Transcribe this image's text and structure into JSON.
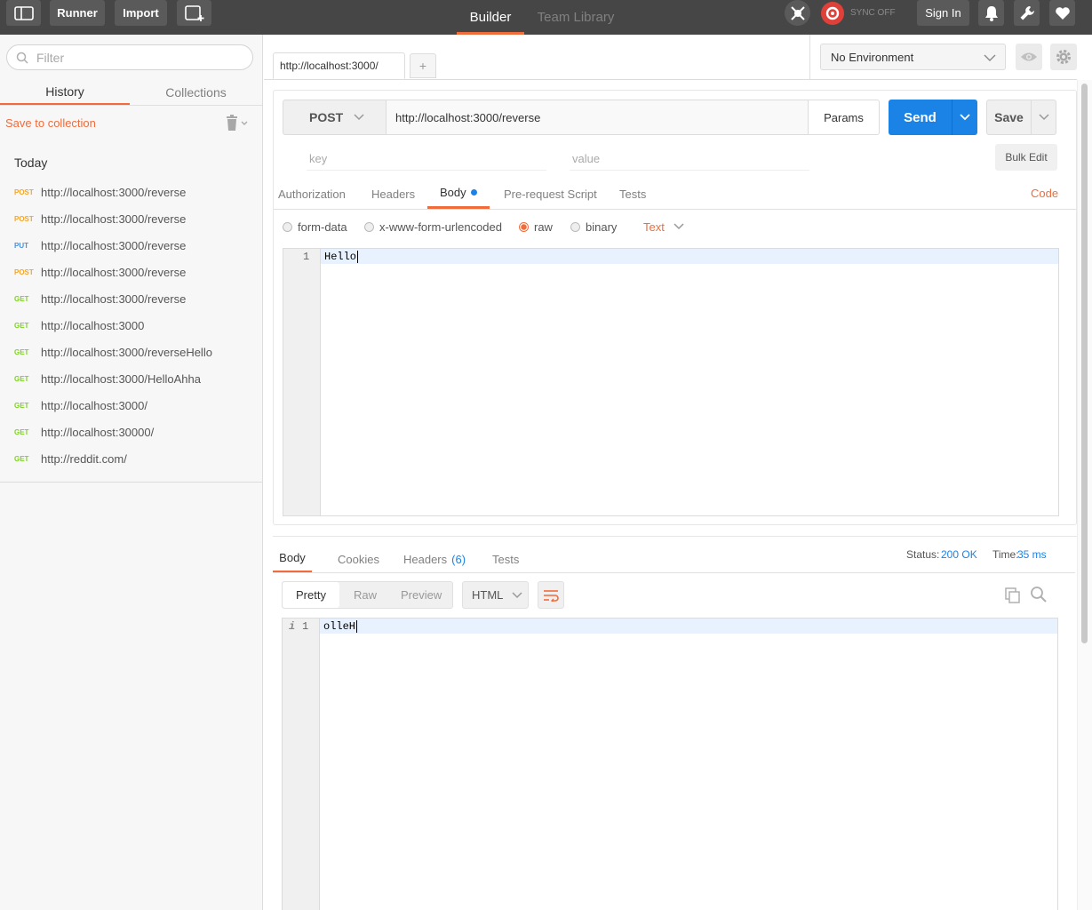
{
  "topbar": {
    "runner_label": "Runner",
    "import_label": "Import",
    "builder_label": "Builder",
    "team_library_label": "Team Library",
    "sync_label": "SYNC OFF",
    "sign_in_label": "Sign In"
  },
  "sidebar": {
    "filter_placeholder": "Filter",
    "tabs": [
      {
        "label": "History"
      },
      {
        "label": "Collections"
      }
    ],
    "save_to_collection": "Save to collection",
    "group_label": "Today",
    "history": [
      {
        "method": "POST",
        "url": "http://localhost:3000/reverse"
      },
      {
        "method": "POST",
        "url": "http://localhost:3000/reverse"
      },
      {
        "method": "PUT",
        "url": "http://localhost:3000/reverse"
      },
      {
        "method": "POST",
        "url": "http://localhost:3000/reverse"
      },
      {
        "method": "GET",
        "url": "http://localhost:3000/reverse"
      },
      {
        "method": "GET",
        "url": "http://localhost:3000"
      },
      {
        "method": "GET",
        "url": "http://localhost:3000/reverseHello"
      },
      {
        "method": "GET",
        "url": "http://localhost:3000/HelloAhha"
      },
      {
        "method": "GET",
        "url": "http://localhost:3000/"
      },
      {
        "method": "GET",
        "url": "http://localhost:30000/"
      },
      {
        "method": "GET",
        "url": "http://reddit.com/"
      }
    ]
  },
  "main": {
    "tab_label": "http://localhost:3000/",
    "new_tab_label": "+",
    "environment": "No Environment",
    "request": {
      "method": "POST",
      "url": "http://localhost:3000/reverse",
      "params_label": "Params",
      "send_label": "Send",
      "save_label": "Save",
      "key_placeholder": "key",
      "value_placeholder": "value",
      "bulk_edit_label": "Bulk Edit",
      "tabs": [
        {
          "label": "Authorization"
        },
        {
          "label": "Headers"
        },
        {
          "label": "Body"
        },
        {
          "label": "Pre-request Script"
        },
        {
          "label": "Tests"
        }
      ],
      "code_label": "Code",
      "body_modes": [
        {
          "label": "form-data"
        },
        {
          "label": "x-www-form-urlencoded"
        },
        {
          "label": "raw"
        },
        {
          "label": "binary"
        }
      ],
      "raw_type": "Text",
      "body_line_number": "1",
      "body_text": "Hello"
    },
    "response": {
      "tabs": [
        {
          "label": "Body"
        },
        {
          "label": "Cookies"
        },
        {
          "label": "Headers"
        },
        {
          "label": "Tests"
        }
      ],
      "headers_count": "(6)",
      "status_label": "Status:",
      "status_value": "200 OK",
      "time_label": "Time:",
      "time_value": "35 ms",
      "views": [
        {
          "label": "Pretty"
        },
        {
          "label": "Raw"
        },
        {
          "label": "Preview"
        }
      ],
      "format": "HTML",
      "info_marker": "i",
      "line_number": "1",
      "body_text": "olleH"
    }
  },
  "colors": {
    "accent": "#f26b3a",
    "send_blue": "#1b83e6",
    "topbar": "#464646",
    "post": "#f5a623",
    "put": "#4a90e2",
    "get": "#7ed321"
  }
}
